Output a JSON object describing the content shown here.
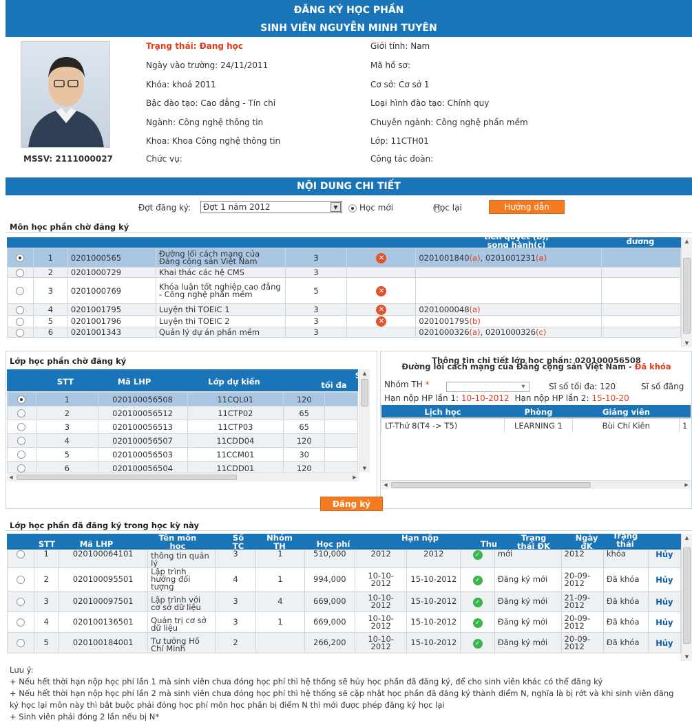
{
  "header": {
    "title": "ĐĂNG KÝ HỌC PHẦN",
    "student_name": "SINH VIÊN NGUYỄN MINH TUYÊN"
  },
  "profile": {
    "mssv": "MSSV: 2111000027",
    "left": [
      "Trạng thái: Đang học",
      "Ngày vào trường: 24/11/2011",
      "Khóa: khoá 2011",
      "Bậc đào tạo: Cao đẳng - Tín chỉ",
      "Ngành: Công nghệ thông tin",
      "Khoa: Khoa Công nghệ thông tin",
      "Chức vụ:"
    ],
    "right": [
      "Giới tính: Nam",
      "Mã hồ sơ:",
      "Cơ sở: Cơ sở 1",
      "Loại hình đào tạo: Chính quy",
      "Chuyên ngành: Công nghệ phần mềm",
      "Lớp: 11CTH01",
      "Công tác đoàn:"
    ]
  },
  "detail": {
    "title": "NỘI DUNG CHI TIẾT",
    "period_label": "Đợt đăng ký:",
    "period_value": "Đợt 1 năm 2012",
    "radio_new": "Học mới",
    "radio_retake": "Học lại",
    "guide_button": "Hướng dẫn"
  },
  "pending_courses": {
    "title": "Môn học phần chờ đăng ký",
    "header_prereq": "tiên quyết (b),\nsong hành(c)",
    "header_equiv": "đương",
    "rows": [
      {
        "stt": "1",
        "code": "0201000565",
        "name": "Đường lối cách mạng của Đảng cộng sản Việt Nam",
        "tc": "3",
        "prereq": [
          [
            "0201001840",
            "(a)"
          ],
          [
            "0201001231",
            "(a)"
          ]
        ]
      },
      {
        "stt": "2",
        "code": "0201000729",
        "name": "Khai thác các hệ CMS",
        "tc": "3",
        "prereq": []
      },
      {
        "stt": "3",
        "code": "0201000769",
        "name": "Khóa luận tốt nghiệp cao đẳng - Công nghệ phần mềm",
        "tc": "5",
        "prereq": []
      },
      {
        "stt": "4",
        "code": "0201001795",
        "name": "Luyện thi TOEIC 1",
        "tc": "3",
        "prereq": [
          [
            "0201000048",
            "(a)"
          ]
        ]
      },
      {
        "stt": "5",
        "code": "0201001796",
        "name": "Luyện thi TOEIC 2",
        "tc": "3",
        "prereq": [
          [
            "0201001795",
            "(b)"
          ]
        ]
      },
      {
        "stt": "6",
        "code": "0201001343",
        "name": "Quản lý dự án phần mềm",
        "tc": "3",
        "prereq": [
          [
            "0201000326",
            "(a)"
          ],
          [
            "0201000326",
            "(c)"
          ]
        ]
      }
    ]
  },
  "pending_classes": {
    "title": "Lớp học phần chờ đăng ký",
    "headers": {
      "stt": "STT",
      "code": "Mã LHP",
      "class": "Lớp dự kiến",
      "max": "tối đa",
      "s": "S"
    },
    "rows": [
      {
        "stt": "1",
        "code": "020100056508",
        "class": "11CQL01",
        "max": "120"
      },
      {
        "stt": "2",
        "code": "020100056512",
        "class": "11CTP02",
        "max": "65"
      },
      {
        "stt": "3",
        "code": "020100056513",
        "class": "11CTP03",
        "max": "65"
      },
      {
        "stt": "4",
        "code": "020100056507",
        "class": "11CDD04",
        "max": "120"
      },
      {
        "stt": "5",
        "code": "020100056503",
        "class": "11CCM01",
        "max": "30"
      },
      {
        "stt": "6",
        "code": "020100056504",
        "class": "11CDD01",
        "max": "120"
      }
    ]
  },
  "class_detail": {
    "title": "Thông tin chi tiết lớp học phần: 020100056508",
    "course_line": "Đường lối cách mạng của Đảng cộng sản Việt Nam - ",
    "status": "Đã khóa",
    "group_label": "Nhóm TH",
    "max_label": "Sĩ số tối đa: 120",
    "reg_label": "Sĩ số đăng",
    "due1_label": "Hạn nộp HP lần 1:",
    "due1": "10-10-2012",
    "due2_label": "Hạn nộp HP lần 2:",
    "due2": "15-10-20",
    "headers": {
      "schedule": "Lịch học",
      "room": "Phòng",
      "teacher": "Giảng viên"
    },
    "row": {
      "schedule": "LT-Thứ 8(T4 -> T5)",
      "room": "LEARNING 1",
      "teacher": "Bùi Chí Kiên",
      "extra": "1"
    }
  },
  "register_button": "Đăng ký",
  "registered": {
    "title": "Lớp học phần đã đăng ký trong học kỳ này",
    "headers": {
      "stt": "STT",
      "code": "Mã LHP",
      "name": "Tên môn\nhọc",
      "tc": "Số\nTC",
      "group": "Nhóm\nTH",
      "fee": "Học phí",
      "due": "Hạn nộp",
      "paid": "Thu",
      "status": "Trạng\nthái ĐK",
      "date": "Ngày\nđK",
      "state": "Trạng\nthái"
    },
    "cancel": "Hủy",
    "rows": [
      {
        "stt": "1",
        "code": "020100064101",
        "name": "thông tin quản lý",
        "tc": "3",
        "group": "1",
        "fee": "510,000",
        "due1": "2012",
        "due2": "2012",
        "status": "mới",
        "date": "2012",
        "state": "khóa"
      },
      {
        "stt": "2",
        "code": "020100095501",
        "name": "Lập trình hướng đối tượng",
        "tc": "4",
        "group": "1",
        "fee": "994,000",
        "due1": "10-10-2012",
        "due2": "15-10-2012",
        "status": "Đăng ký mới",
        "date": "20-09-2012",
        "state": "Đã khóa"
      },
      {
        "stt": "3",
        "code": "020100097501",
        "name": "Lập trình với cơ sở dữ liệu",
        "tc": "3",
        "group": "4",
        "fee": "669,000",
        "due1": "10-10-2012",
        "due2": "15-10-2012",
        "status": "Đăng ký mới",
        "date": "21-09-2012",
        "state": "Đã khóa"
      },
      {
        "stt": "4",
        "code": "020100136501",
        "name": "Quản trị cơ sở dữ liệu",
        "tc": "3",
        "group": "1",
        "fee": "669,000",
        "due1": "10-10-2012",
        "due2": "15-10-2012",
        "status": "Đăng ký mới",
        "date": "20-09-2012",
        "state": "Đã khóa"
      },
      {
        "stt": "5",
        "code": "020100184001",
        "name": "Tư tưởng Hồ Chí Minh",
        "tc": "2",
        "group": "",
        "fee": "266,200",
        "due1": "10-10-2012",
        "due2": "15-10-2012",
        "status": "Đăng ký mới",
        "date": "20-09-2012",
        "state": "Đã khóa"
      }
    ]
  },
  "notes": [
    "Lưu ý:",
    "+ Nếu hết thời hạn nộp học phí lần 1 mà sinh viên chưa đóng học phí thì hệ thống sẽ hủy học phần đã đăng ký, để cho sinh viên khác có thể đăng ký",
    "+ Nếu hết thời hạn nộp học phí lần 2 mà sinh viên chưa đóng học phí thì hệ thống sẽ cập nhật học phần đã đăng ký thành điểm N, nghĩa là bị rớt và khi sinh viên đăng ký học lại môn này thì bắt buộc phải đóng học phí môn học phần bị điểm N thì mới được phép đăng ký học lại",
    "+ Sinh viên phải đóng 2 lần nếu bị N*"
  ],
  "colors": {
    "header_blue": "#1a74b8",
    "accent_orange": "#f47b20",
    "status_red": "#e53b1a",
    "selected_row": "#a9c6e3"
  }
}
